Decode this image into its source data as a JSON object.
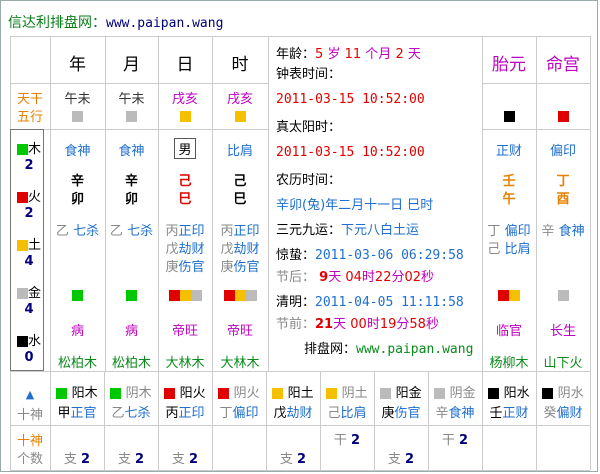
{
  "header": {
    "title": "信达利排盘网：",
    "url": "www.paipan.wang"
  },
  "columns": {
    "year": "年",
    "month": "月",
    "day": "日",
    "hour": "时",
    "taiyuan": "胎元",
    "minggong": "命宫"
  },
  "row_labels": {
    "tiangan": "天干",
    "wuxing": "五行"
  },
  "tiangan_shishen": {
    "year": "午未",
    "month": "午未",
    "day": "戌亥",
    "hour": "戌亥"
  },
  "wuxing_counts": [
    {
      "name": "木",
      "count": "2",
      "color": "#00c800"
    },
    {
      "name": "火",
      "count": "2",
      "color": "#e00000"
    },
    {
      "name": "土",
      "count": "4",
      "color": "#f5c000"
    },
    {
      "name": "金",
      "count": "4",
      "color": "#bbbbbb"
    },
    {
      "name": "水",
      "count": "0",
      "color": "#000000"
    }
  ],
  "shishen_top": {
    "year": "食神",
    "month": "食神",
    "day": "男",
    "hour": "比肩",
    "taiyuan": "正财",
    "minggong": "偏印"
  },
  "ganzhi": {
    "year": [
      "辛",
      "卯"
    ],
    "month": [
      "辛",
      "卯"
    ],
    "day": [
      "己",
      "巳"
    ],
    "hour": [
      "己",
      "巳"
    ],
    "taiyuan": [
      "壬",
      "午"
    ],
    "minggong": [
      "丁",
      "酉"
    ]
  },
  "canggan": {
    "year": [
      {
        "g": "乙",
        "s": "七杀"
      }
    ],
    "month": [
      {
        "g": "乙",
        "s": "七杀"
      }
    ],
    "day": [
      {
        "g": "丙",
        "s": "正印"
      },
      {
        "g": "戊",
        "s": "劫财"
      },
      {
        "g": "庚",
        "s": "伤官"
      }
    ],
    "hour": [
      {
        "g": "丙",
        "s": "正印"
      },
      {
        "g": "戊",
        "s": "劫财"
      },
      {
        "g": "庚",
        "s": "伤官"
      }
    ],
    "taiyuan": [
      {
        "g": "丁",
        "s": "偏印"
      },
      {
        "g": "己",
        "s": "比肩"
      }
    ],
    "minggong": [
      {
        "g": "辛",
        "s": "食神"
      }
    ]
  },
  "changsheng": {
    "year": "病",
    "month": "病",
    "day": "帝旺",
    "hour": "帝旺",
    "taiyuan": "临官",
    "minggong": "长生"
  },
  "nayin": {
    "year": "松柏木",
    "month": "松柏木",
    "day": "大林木",
    "hour": "大林木",
    "taiyuan": "杨柳木",
    "minggong": "山下火"
  },
  "info": {
    "age_label": "年龄：",
    "age_years": "5",
    "age_y_unit": "岁",
    "age_months": "11",
    "age_m_unit": "个月",
    "age_days": "2",
    "age_d_unit": "天",
    "clock_label": "钟表时间：",
    "clock_value": "2011-03-15 10:52:00",
    "solar_label": "真太阳时：",
    "solar_value": "2011-03-15 10:52:00",
    "lunar_label": "农历时间：",
    "lunar_value": "辛卯(兔)年二月十一日 巳时",
    "sanyuan_label": "三元九运：",
    "sanyuan_value": "下元八白土运",
    "jingzhe_label": "惊蛰：",
    "jingzhe_value": "2011-03-06 06:29:58",
    "after_label": "节后：",
    "after_days": "9",
    "after_days_unit": "天",
    "after_h": "04",
    "after_h_unit": "时",
    "after_m": "22",
    "after_m_unit": "分",
    "after_s": "02",
    "after_s_unit": "秒",
    "qingming_label": "清明：",
    "qingming_value": "2011-04-05 11:11:58",
    "before_label": "节前：",
    "before_days": "21",
    "before_days_unit": "天",
    "before_h": "00",
    "before_h_unit": "时",
    "before_m": "19",
    "before_m_unit": "分",
    "before_s": "58",
    "before_s_unit": "秒",
    "site_label": "排盘网：",
    "site_value": "www.paipan.wang"
  },
  "bottom": {
    "label_shishen": "十神",
    "label_count": "十神\n个数",
    "label_shishen_l1": "十神",
    "label_count_l1": "十神",
    "label_count_l2": "个数",
    "cells": [
      {
        "el": "阳木",
        "g": "甲",
        "s": "正官",
        "kind": "支",
        "n": "2"
      },
      {
        "el": "阴木",
        "g": "乙",
        "s": "七杀",
        "kind": "支",
        "n": "2"
      },
      {
        "el": "阳火",
        "g": "丙",
        "s": "正印",
        "kind": "支",
        "n": "2"
      },
      {
        "el": "阴火",
        "g": "丁",
        "s": "偏印",
        "kind": "",
        "n": ""
      },
      {
        "el": "阳土",
        "g": "戊",
        "s": "劫财",
        "kind": "支",
        "n": "2"
      },
      {
        "el": "阴土",
        "g": "己",
        "s": "比肩",
        "kind": "干",
        "n": "2"
      },
      {
        "el": "阳金",
        "g": "庚",
        "s": "伤官",
        "kind": "支",
        "n": "2"
      },
      {
        "el": "阴金",
        "g": "辛",
        "s": "食神",
        "kind": "干",
        "n": "2"
      },
      {
        "el": "阳水",
        "g": "壬",
        "s": "正财",
        "kind": "",
        "n": ""
      },
      {
        "el": "阴水",
        "g": "癸",
        "s": "偏财",
        "kind": "",
        "n": ""
      }
    ]
  }
}
